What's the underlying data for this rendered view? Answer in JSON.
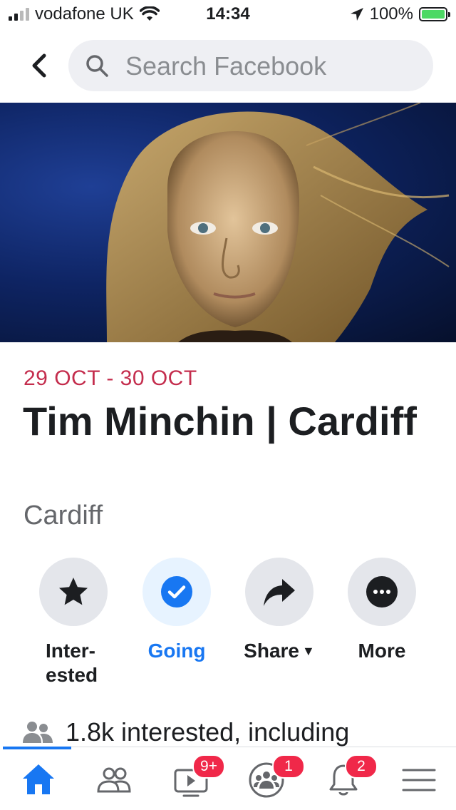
{
  "status_bar": {
    "carrier": "vodafone UK",
    "time": "14:34",
    "battery": "100%",
    "battery_level": 1.0
  },
  "search": {
    "placeholder": "Search Facebook"
  },
  "event": {
    "date": "29 OCT - 30 OCT",
    "title": "Tim Minchin | Cardiff",
    "location": "Cardiff"
  },
  "actions": {
    "interested": "Inter-\nested",
    "going": "Going",
    "share": "Share",
    "more": "More"
  },
  "interest_summary": "1.8k interested, including",
  "nav": {
    "watch_badge": "9+",
    "groups_badge": "1",
    "notifications_badge": "2"
  },
  "colors": {
    "accent": "#1877f2",
    "date": "#c42d4d",
    "badge": "#f02849"
  },
  "icons": [
    "back-arrow-icon",
    "search-icon",
    "star-icon",
    "check-circle-icon",
    "share-arrow-icon",
    "more-dots-icon",
    "people-icon",
    "home-icon",
    "friends-icon",
    "watch-icon",
    "groups-icon",
    "bell-icon",
    "menu-icon"
  ]
}
